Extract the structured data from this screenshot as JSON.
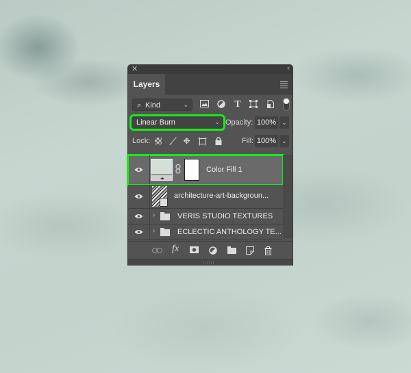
{
  "panel": {
    "tab_label": "Layers",
    "filter": {
      "label": "Kind",
      "icon": "search-icon"
    },
    "filter_icons": [
      "image-filter-icon",
      "adjustment-filter-icon",
      "type-filter-icon",
      "shape-filter-icon",
      "smart-object-filter-icon"
    ],
    "blend_mode": "Linear Burn",
    "opacity_label": "Opacity:",
    "opacity_value": "100%",
    "lock_label": "Lock:",
    "fill_label": "Fill:",
    "fill_value": "100%",
    "layers": [
      {
        "name": "Color Fill 1",
        "type": "fill",
        "visible": true,
        "selected": true
      },
      {
        "name": "architecture-art-backgroun...",
        "type": "smart-object",
        "visible": true,
        "selected": false
      },
      {
        "name": "VERIS STUDIO TEXTURES",
        "type": "group",
        "visible": true,
        "selected": false
      },
      {
        "name": "ECLECTIC ANTHOLOGY TE...",
        "type": "group",
        "visible": true,
        "selected": false
      }
    ],
    "bottom_icons": [
      "link-layers-icon",
      "fx-icon",
      "add-mask-icon",
      "adjustment-layer-icon",
      "new-group-icon",
      "new-layer-icon",
      "trash-icon"
    ],
    "fx_label": "fx"
  },
  "colors": {
    "highlight": "#16ec16",
    "fill_swatch": "#d2e0d8"
  }
}
